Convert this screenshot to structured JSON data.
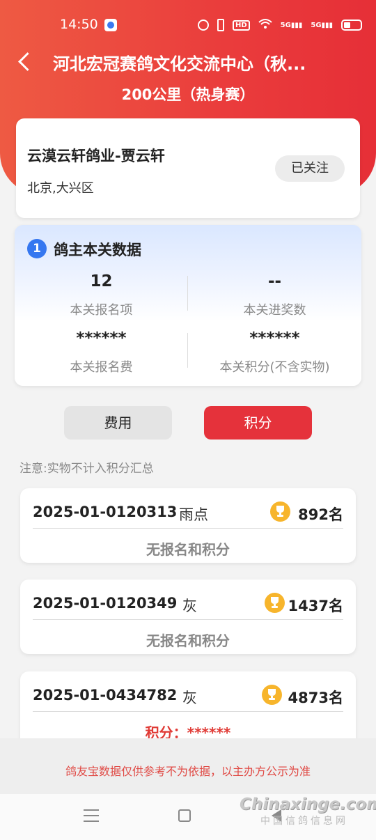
{
  "status_bar": {
    "time": "14:50",
    "hd": "HD",
    "sig1": "5G",
    "sig2": "5G"
  },
  "header": {
    "title": "河北宏冠赛鸽文化交流中心（秋...",
    "subtitle": "200公里（热身赛）",
    "back_icon": "chevron-left-icon",
    "background": "#ea3c3c"
  },
  "owner": {
    "name": "云漠云轩鸽业-贾云轩",
    "location": "北京,大兴区",
    "follow_label": "已关注"
  },
  "stats": {
    "badge": "1",
    "title": "鸽主本关数据",
    "items": [
      {
        "value": "12",
        "label": "本关报名项"
      },
      {
        "value": "--",
        "label": "本关进奖数"
      },
      {
        "value": "******",
        "label": "本关报名费"
      },
      {
        "value": "******",
        "label": "本关积分(不含实物)"
      }
    ]
  },
  "tabs": {
    "fee": "费用",
    "score": "积分",
    "active": "score",
    "active_color": "#e5323b"
  },
  "note": "注意:实物不计入积分汇总",
  "entries": [
    {
      "ring": "2025-01-0120313",
      "color": "雨点",
      "rank": "892名",
      "note": "无报名和积分"
    },
    {
      "ring": "2025-01-0120349",
      "color": "灰",
      "rank": "1437名",
      "note": "无报名和积分"
    },
    {
      "ring": "2025-01-0434782",
      "color": "灰",
      "rank": "4873名",
      "note": "积分：******"
    }
  ],
  "disclaimer": "鸽友宝数据仅供参考不为依据，以主办方公示为准",
  "watermark": {
    "main": "Chinaxinge.com",
    "sub": "中国信鸽信息网"
  }
}
